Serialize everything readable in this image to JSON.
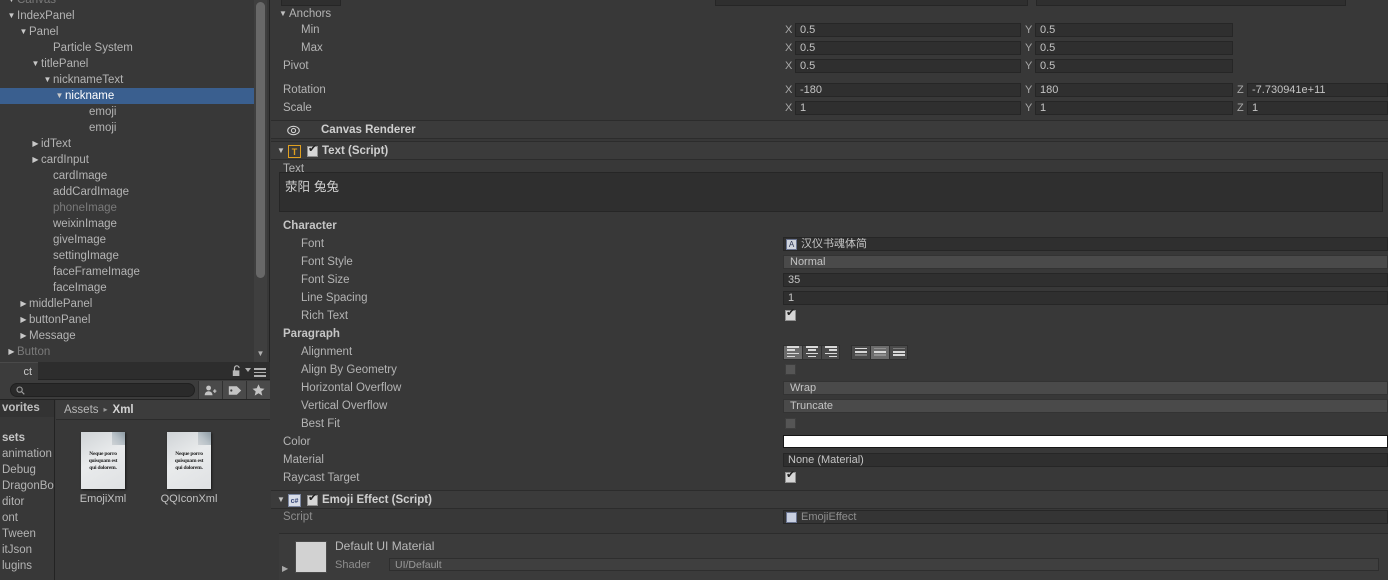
{
  "hierarchy": {
    "items": [
      {
        "label": "Canvas",
        "indent": 0,
        "arrow": "down",
        "dim": true,
        "clipped": true
      },
      {
        "label": "IndexPanel",
        "indent": 0,
        "arrow": "down",
        "dim": false
      },
      {
        "label": "Panel",
        "indent": 1,
        "arrow": "down",
        "dim": false
      },
      {
        "label": "Particle System",
        "indent": 3,
        "arrow": "none",
        "dim": false
      },
      {
        "label": "titlePanel",
        "indent": 2,
        "arrow": "down",
        "dim": false
      },
      {
        "label": "nicknameText",
        "indent": 3,
        "arrow": "down",
        "dim": false
      },
      {
        "label": "nickname",
        "indent": 4,
        "arrow": "down",
        "dim": false,
        "selected": true
      },
      {
        "label": "emoji",
        "indent": 6,
        "arrow": "none",
        "dim": false
      },
      {
        "label": "emoji",
        "indent": 6,
        "arrow": "none",
        "dim": false
      },
      {
        "label": "idText",
        "indent": 2,
        "arrow": "right",
        "dim": false
      },
      {
        "label": "cardInput",
        "indent": 2,
        "arrow": "right",
        "dim": false
      },
      {
        "label": "cardImage",
        "indent": 3,
        "arrow": "none",
        "dim": false
      },
      {
        "label": "addCardImage",
        "indent": 3,
        "arrow": "none",
        "dim": false
      },
      {
        "label": "phoneImage",
        "indent": 3,
        "arrow": "none",
        "dim": true
      },
      {
        "label": "weixinImage",
        "indent": 3,
        "arrow": "none",
        "dim": false
      },
      {
        "label": "giveImage",
        "indent": 3,
        "arrow": "none",
        "dim": false
      },
      {
        "label": "settingImage",
        "indent": 3,
        "arrow": "none",
        "dim": false
      },
      {
        "label": "faceFrameImage",
        "indent": 3,
        "arrow": "none",
        "dim": false
      },
      {
        "label": "faceImage",
        "indent": 3,
        "arrow": "none",
        "dim": false
      },
      {
        "label": "middlePanel",
        "indent": 1,
        "arrow": "right",
        "dim": false
      },
      {
        "label": "buttonPanel",
        "indent": 1,
        "arrow": "right",
        "dim": false
      },
      {
        "label": "Message",
        "indent": 1,
        "arrow": "right",
        "dim": false
      },
      {
        "label": "Button",
        "indent": 0,
        "arrow": "right",
        "dim": true
      }
    ]
  },
  "project": {
    "tab_label": "ct",
    "lock_icon": "lock-open-icon",
    "menu_icon": "hamburger-menu-icon",
    "search": {
      "value": "",
      "placeholder": ""
    },
    "toolbar_icons": [
      "person-filter-icon",
      "label-filter-icon",
      "star-favorite-icon"
    ],
    "breadcrumb": {
      "root": "Assets",
      "separator": "▸",
      "current": "Xml"
    },
    "sidebar": {
      "favorites_header": "vorites",
      "items": [
        {
          "label": "sets",
          "bold": true
        },
        {
          "label": "animation",
          "bold": false
        },
        {
          "label": "Debug",
          "bold": false
        },
        {
          "label": "DragonBon",
          "bold": false
        },
        {
          "label": "ditor",
          "bold": false
        },
        {
          "label": "ont",
          "bold": false
        },
        {
          "label": "Tween",
          "bold": false
        },
        {
          "label": "itJson",
          "bold": false
        },
        {
          "label": "lugins",
          "bold": false
        }
      ]
    },
    "assets": [
      {
        "name": "EmojiXml",
        "thumb_lines": [
          "Neque porro",
          "quisquam est",
          "qui dolorem."
        ]
      },
      {
        "name": "QQIconXml",
        "thumb_lines": [
          "Neque porro",
          "quisquam est",
          "qui dolorem."
        ]
      }
    ]
  },
  "inspector": {
    "rect_transform": {
      "anchors_label": "Anchors",
      "rows": [
        {
          "label": "Min",
          "x": "0.5",
          "y": "0.5",
          "z": null
        },
        {
          "label": "Max",
          "x": "0.5",
          "y": "0.5",
          "z": null
        },
        {
          "label": "Pivot",
          "x": "0.5",
          "y": "0.5",
          "z": null
        }
      ],
      "rotation": {
        "label": "Rotation",
        "x": "-180",
        "y": "180",
        "z": "-7.730941e+11"
      },
      "scale": {
        "label": "Scale",
        "x": "1",
        "y": "1",
        "z": "1"
      },
      "axis_x": "X",
      "axis_y": "Y",
      "axis_z": "Z"
    },
    "canvas_renderer": {
      "title": "Canvas Renderer",
      "icon": "eye-icon"
    },
    "text_component": {
      "title": "Text (Script)",
      "icon": "text-script-icon",
      "enabled": true,
      "text_label": "Text",
      "text_value": "荥阳 兔兔",
      "character": {
        "header": "Character",
        "font_label": "Font",
        "font_value": "汉仪书魂体简",
        "font_style_label": "Font Style",
        "font_style_value": "Normal",
        "font_size_label": "Font Size",
        "font_size_value": "35",
        "line_spacing_label": "Line Spacing",
        "line_spacing_value": "1",
        "rich_text_label": "Rich Text",
        "rich_text_value": true
      },
      "paragraph": {
        "header": "Paragraph",
        "alignment_label": "Alignment",
        "align_horizontal": [
          "left",
          "center",
          "right"
        ],
        "align_horizontal_selected": 0,
        "align_vertical": [
          "top",
          "middle",
          "bottom"
        ],
        "align_vertical_selected": 1,
        "align_by_geometry_label": "Align By Geometry",
        "align_by_geometry_value": false,
        "horizontal_overflow_label": "Horizontal Overflow",
        "horizontal_overflow_value": "Wrap",
        "vertical_overflow_label": "Vertical Overflow",
        "vertical_overflow_value": "Truncate",
        "best_fit_label": "Best Fit",
        "best_fit_value": false
      },
      "color_label": "Color",
      "color_value": "#ffffff",
      "material_label": "Material",
      "material_value": "None (Material)",
      "raycast_target_label": "Raycast Target",
      "raycast_target_value": true
    },
    "emoji_effect": {
      "title": "Emoji Effect (Script)",
      "icon": "csharp-script-icon",
      "enabled": true,
      "script_label": "Script",
      "script_value": "EmojiEffect"
    },
    "material_preview": {
      "name": "Default UI Material",
      "shader_label": "Shader",
      "shader_value": "UI/Default"
    }
  }
}
